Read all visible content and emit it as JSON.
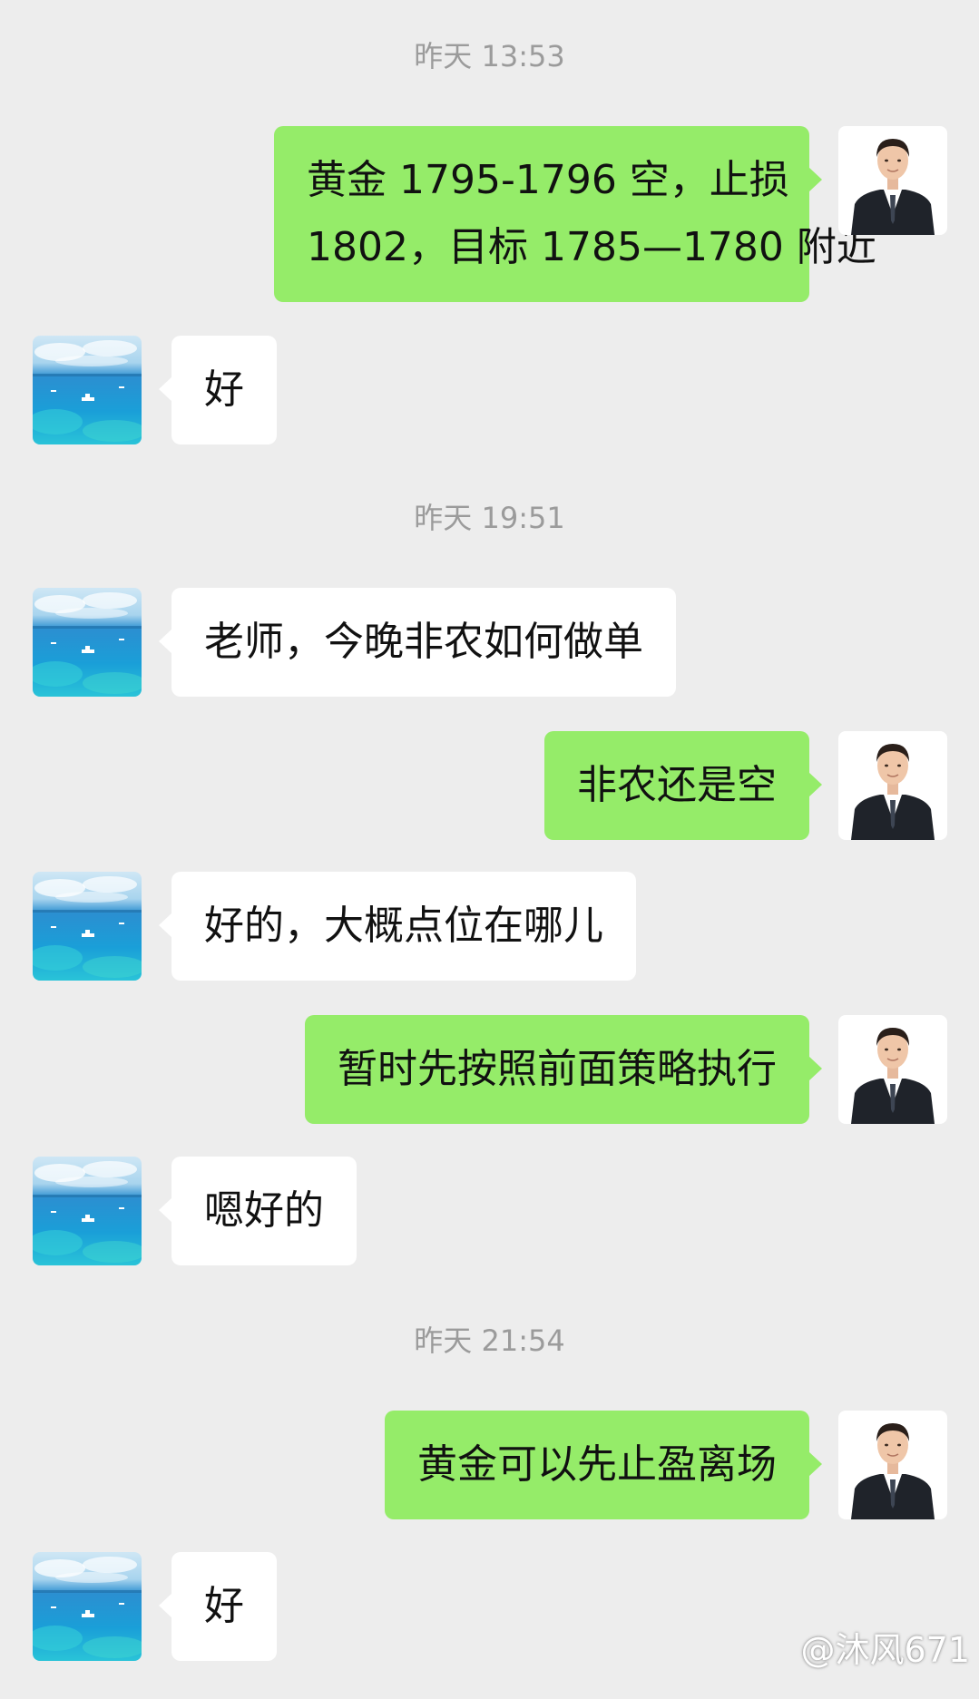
{
  "chat": {
    "timestamps": [
      "昨天 13:53",
      "昨天 19:51",
      "昨天 21:54"
    ],
    "messages": [
      {
        "sender": "self",
        "lines": [
          "黄金 1795-1796 空，止损",
          "1802，目标 1785—1780 附近"
        ]
      },
      {
        "sender": "other",
        "lines": [
          "好"
        ]
      },
      {
        "sender": "other",
        "lines": [
          "老师，今晚非农如何做单"
        ]
      },
      {
        "sender": "self",
        "lines": [
          "非农还是空"
        ]
      },
      {
        "sender": "other",
        "lines": [
          "好的，大概点位在哪儿"
        ]
      },
      {
        "sender": "self",
        "lines": [
          "暂时先按照前面策略执行"
        ]
      },
      {
        "sender": "other",
        "lines": [
          "嗯好的"
        ]
      },
      {
        "sender": "self",
        "lines": [
          "黄金可以先止盈离场"
        ]
      },
      {
        "sender": "other",
        "lines": [
          "好"
        ]
      }
    ]
  },
  "watermark": "@沐风671",
  "colors": {
    "background": "#ededed",
    "sent_bubble": "#95ec69",
    "received_bubble": "#ffffff",
    "timestamp_text": "#9b9b9b"
  },
  "avatars": {
    "self": "man-in-suit-avatar",
    "other": "sea-landscape-avatar"
  }
}
